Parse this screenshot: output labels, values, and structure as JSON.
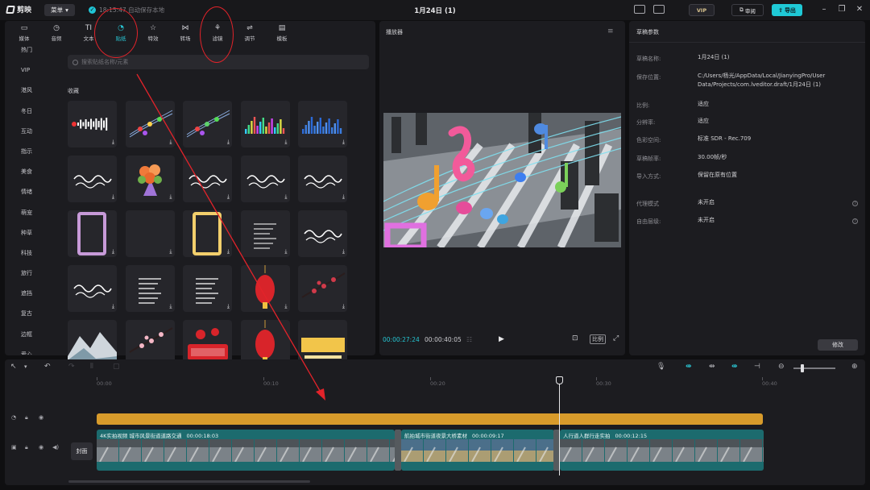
{
  "titlebar": {
    "app_name": "剪映",
    "menu_label": "菜单",
    "save_status": "18:15:47 自动保存本地",
    "doc_title": "1月24日 (1)",
    "vip_label": "VIP",
    "share_label": "审阅",
    "export_label": "导出"
  },
  "tools": [
    {
      "icon": "media-icon",
      "label": "媒体",
      "glyph": "▭"
    },
    {
      "icon": "audio-icon",
      "label": "音频",
      "glyph": "◷"
    },
    {
      "icon": "text-icon",
      "label": "文本",
      "glyph": "TI"
    },
    {
      "icon": "sticker-icon",
      "label": "贴纸",
      "glyph": "◔",
      "active": true
    },
    {
      "icon": "effects-icon",
      "label": "特效",
      "glyph": "☆"
    },
    {
      "icon": "transition-icon",
      "label": "转场",
      "glyph": "⋈"
    },
    {
      "icon": "filter-icon",
      "label": "滤镜",
      "glyph": "⚘"
    },
    {
      "icon": "adjust-icon",
      "label": "调节",
      "glyph": "⇌"
    },
    {
      "icon": "template-icon",
      "label": "模板",
      "glyph": "▤"
    }
  ],
  "categories": [
    "热门",
    "VIP",
    "港风",
    "冬日",
    "互动",
    "指示",
    "美食",
    "情绪",
    "萌宠",
    "种草",
    "科技",
    "旅行",
    "遮挡",
    "复古",
    "边框",
    "爱心"
  ],
  "search": {
    "placeholder": "搜索贴纸名称/元素"
  },
  "favorites_label": "收藏",
  "stickers": [
    {
      "name": "sticker-soundwave-white",
      "kind": "wave",
      "color": "#ffffff",
      "download": true
    },
    {
      "name": "sticker-music-notes-color",
      "kind": "notes",
      "color": "#ffd24a",
      "download": true
    },
    {
      "name": "sticker-music-notes-staff",
      "kind": "notes",
      "color": "#5fd36b",
      "download": true
    },
    {
      "name": "sticker-equalizer-rainbow",
      "kind": "eq",
      "color": "#6dd06a",
      "download": true
    },
    {
      "name": "sticker-equalizer-blue",
      "kind": "eq",
      "color": "#3b7de0",
      "download": true
    },
    {
      "name": "sticker-calligraphy-text",
      "kind": "text",
      "color": "#ffffff",
      "download": true
    },
    {
      "name": "sticker-flower-bouquet",
      "kind": "flower",
      "color": "#f07a3a",
      "download": true
    },
    {
      "name": "sticker-event-text",
      "kind": "text",
      "color": "#ffffff",
      "download": true
    },
    {
      "name": "sticker-make-your-own",
      "kind": "text",
      "color": "#ffffff",
      "download": true
    },
    {
      "name": "sticker-handwritten-quote",
      "kind": "text",
      "color": "#ffffff",
      "download": true
    },
    {
      "name": "sticker-purple-frame",
      "kind": "frame",
      "color": "#c79ad8",
      "download": true
    },
    {
      "name": "sticker-blank",
      "kind": "blank",
      "color": "#26262b",
      "download": true
    },
    {
      "name": "sticker-yellow-frame",
      "kind": "frame",
      "color": "#f2cf6c",
      "download": true
    },
    {
      "name": "sticker-text-list",
      "kind": "lines",
      "color": "#d8d8d8",
      "download": true
    },
    {
      "name": "sticker-chinese-block",
      "kind": "text",
      "color": "#ffffff",
      "download": true
    },
    {
      "name": "sticker-script-lines",
      "kind": "text",
      "color": "#ffffff",
      "download": true
    },
    {
      "name": "sticker-poem-vertical",
      "kind": "lines",
      "color": "#ffffff",
      "download": true
    },
    {
      "name": "sticker-ink-calligraphy",
      "kind": "lines",
      "color": "#ffffff",
      "download": true
    },
    {
      "name": "sticker-red-lantern",
      "kind": "lantern",
      "color": "#d8242a",
      "download": true
    },
    {
      "name": "sticker-plum-blossom",
      "kind": "blossom",
      "color": "#d03a4a",
      "download": true
    },
    {
      "name": "sticker-ink-mountain",
      "kind": "mountain",
      "color": "#cfd6dc",
      "download": false
    },
    {
      "name": "sticker-cherry-branch",
      "kind": "blossom",
      "color": "#f4b7c6",
      "download": false
    },
    {
      "name": "sticker-2024-red",
      "kind": "year",
      "color": "#d8242a",
      "download": false
    },
    {
      "name": "sticker-spring-lantern",
      "kind": "lantern",
      "color": "#d8242a",
      "download": false
    },
    {
      "name": "sticker-2024-gold",
      "kind": "year-gold",
      "color": "#f2c54a",
      "download": false
    }
  ],
  "player": {
    "title": "播放器",
    "time_current": "00:00:27:24",
    "time_total": "00:00:40:05",
    "ratio_label": "比例"
  },
  "draft": {
    "title": "草稿参数",
    "rows": [
      {
        "label": "草稿名称:",
        "value": "1月24日 (1)"
      },
      {
        "label": "保存位置:",
        "value": "C:/Users/杨光/AppData/Local/JianyingPro/User Data/Projects/com.lveditor.draft/1月24日 (1)"
      },
      {
        "label": "比例:",
        "value": "适应"
      },
      {
        "label": "分辨率:",
        "value": "适应"
      },
      {
        "label": "色彩空间:",
        "value": "标准 SDR - Rec.709"
      },
      {
        "label": "草稿帧率:",
        "value": "30.00帧/秒"
      },
      {
        "label": "导入方式:",
        "value": "保留在原有位置"
      },
      {
        "label": "代理模式",
        "value": "未开启",
        "info": true
      },
      {
        "label": "自由层级:",
        "value": "未开启",
        "info": true
      }
    ],
    "modify_label": "修改"
  },
  "timeline": {
    "ticks": [
      "00:00",
      "00:10",
      "00:20",
      "00:30",
      "00:40"
    ],
    "cover_label": "封面",
    "clips": [
      {
        "title": "4K实拍视频 城市风景街道道路交通",
        "duration": "00:00:18:03"
      },
      {
        "title": "航拍城市街道夜景大桥素材",
        "duration": "00:00:09:17"
      },
      {
        "title": "人行道人群行走实拍",
        "duration": "00:00:12:15"
      }
    ]
  },
  "colors": {
    "accent": "#29c6d4",
    "panel": "#1c1c20",
    "audio_track": "#d89b2b",
    "video_track": "#1c6b6e",
    "annotation": "#e3232a"
  }
}
